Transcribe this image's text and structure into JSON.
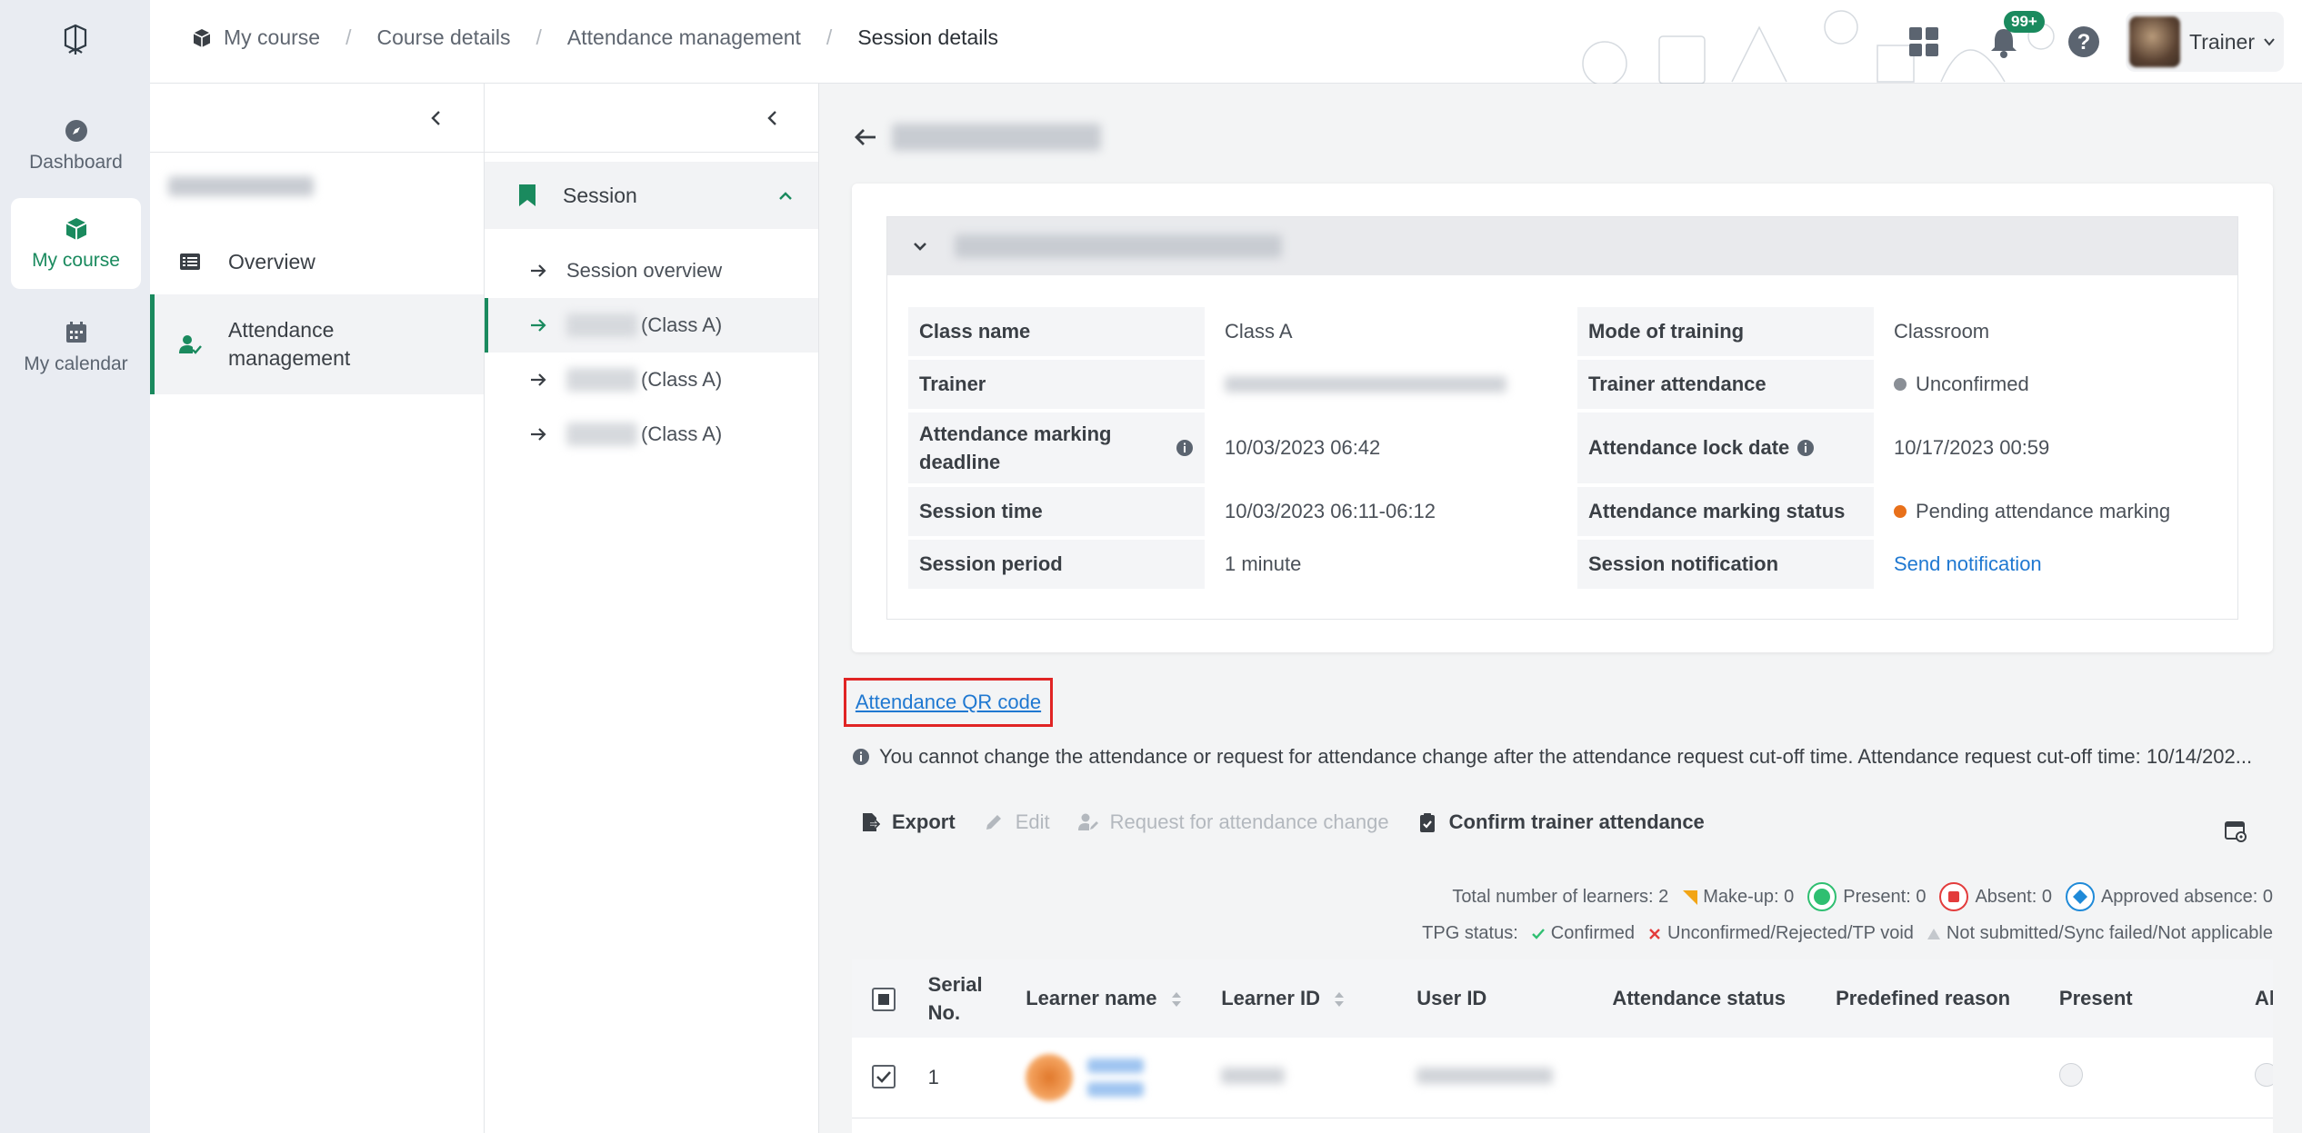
{
  "rail": {
    "items": [
      {
        "label": "Dashboard",
        "icon": "compass-icon"
      },
      {
        "label": "My course",
        "icon": "cube-icon",
        "active": true
      },
      {
        "label": "My calendar",
        "icon": "calendar-icon"
      }
    ]
  },
  "topbar": {
    "breadcrumb": [
      "My course",
      "Course details",
      "Attendance management",
      "Session details"
    ],
    "notification_badge": "99+",
    "user_role": "Trainer"
  },
  "panel1": {
    "items": [
      "Overview",
      "Attendance management"
    ]
  },
  "panel2": {
    "section": "Session",
    "items": [
      "Session overview",
      "(Class A)",
      "(Class A)",
      "(Class A)"
    ]
  },
  "info": {
    "rows": [
      {
        "l1": "Class name",
        "v1": "Class A",
        "l2": "Mode of training",
        "v2": "Classroom"
      },
      {
        "l1": "Trainer",
        "v1": "",
        "l2": "Trainer attendance",
        "v2": "Unconfirmed"
      },
      {
        "l1": "Attendance marking deadline",
        "v1": "10/03/2023 06:42",
        "l2": "Attendance lock date",
        "v2": "10/17/2023 00:59"
      },
      {
        "l1": "Session time",
        "v1": "10/03/2023 06:11-06:12",
        "l2": "Attendance marking status",
        "v2": "Pending attendance marking"
      },
      {
        "l1": "Session period",
        "v1": "1 minute",
        "l2": "Session notification",
        "v2": "Send notification"
      }
    ],
    "status_colors": {
      "unconfirmed": "#8a8f96",
      "pending": "#e8701a"
    }
  },
  "qr_link": "Attendance QR code",
  "notice": "You cannot change the attendance or request for attendance change after the attendance request cut-off time. Attendance request cut-off time: 10/14/202...",
  "toolbar": {
    "export": "Export",
    "edit": "Edit",
    "request": "Request for attendance change",
    "confirm": "Confirm trainer attendance"
  },
  "legend": {
    "total": "Total number of learners: 2",
    "makeup": "Make-up: 0",
    "present": "Present: 0",
    "absent": "Absent: 0",
    "approved": "Approved absence: 0",
    "tpg_label": "TPG status:",
    "confirmed": "Confirmed",
    "unconfirmed": "Unconfirmed/Rejected/TP void",
    "not_submitted": "Not submitted/Sync failed/Not applicable"
  },
  "table": {
    "headers": [
      "Serial No.",
      "Learner name",
      "Learner ID",
      "User ID",
      "Attendance status",
      "Predefined reason",
      "Present",
      "Abse"
    ],
    "rows": [
      {
        "serial": "1"
      }
    ]
  },
  "colors": {
    "accent": "#1a8a5e",
    "link": "#1f78d1",
    "highlight": "#e02424"
  }
}
